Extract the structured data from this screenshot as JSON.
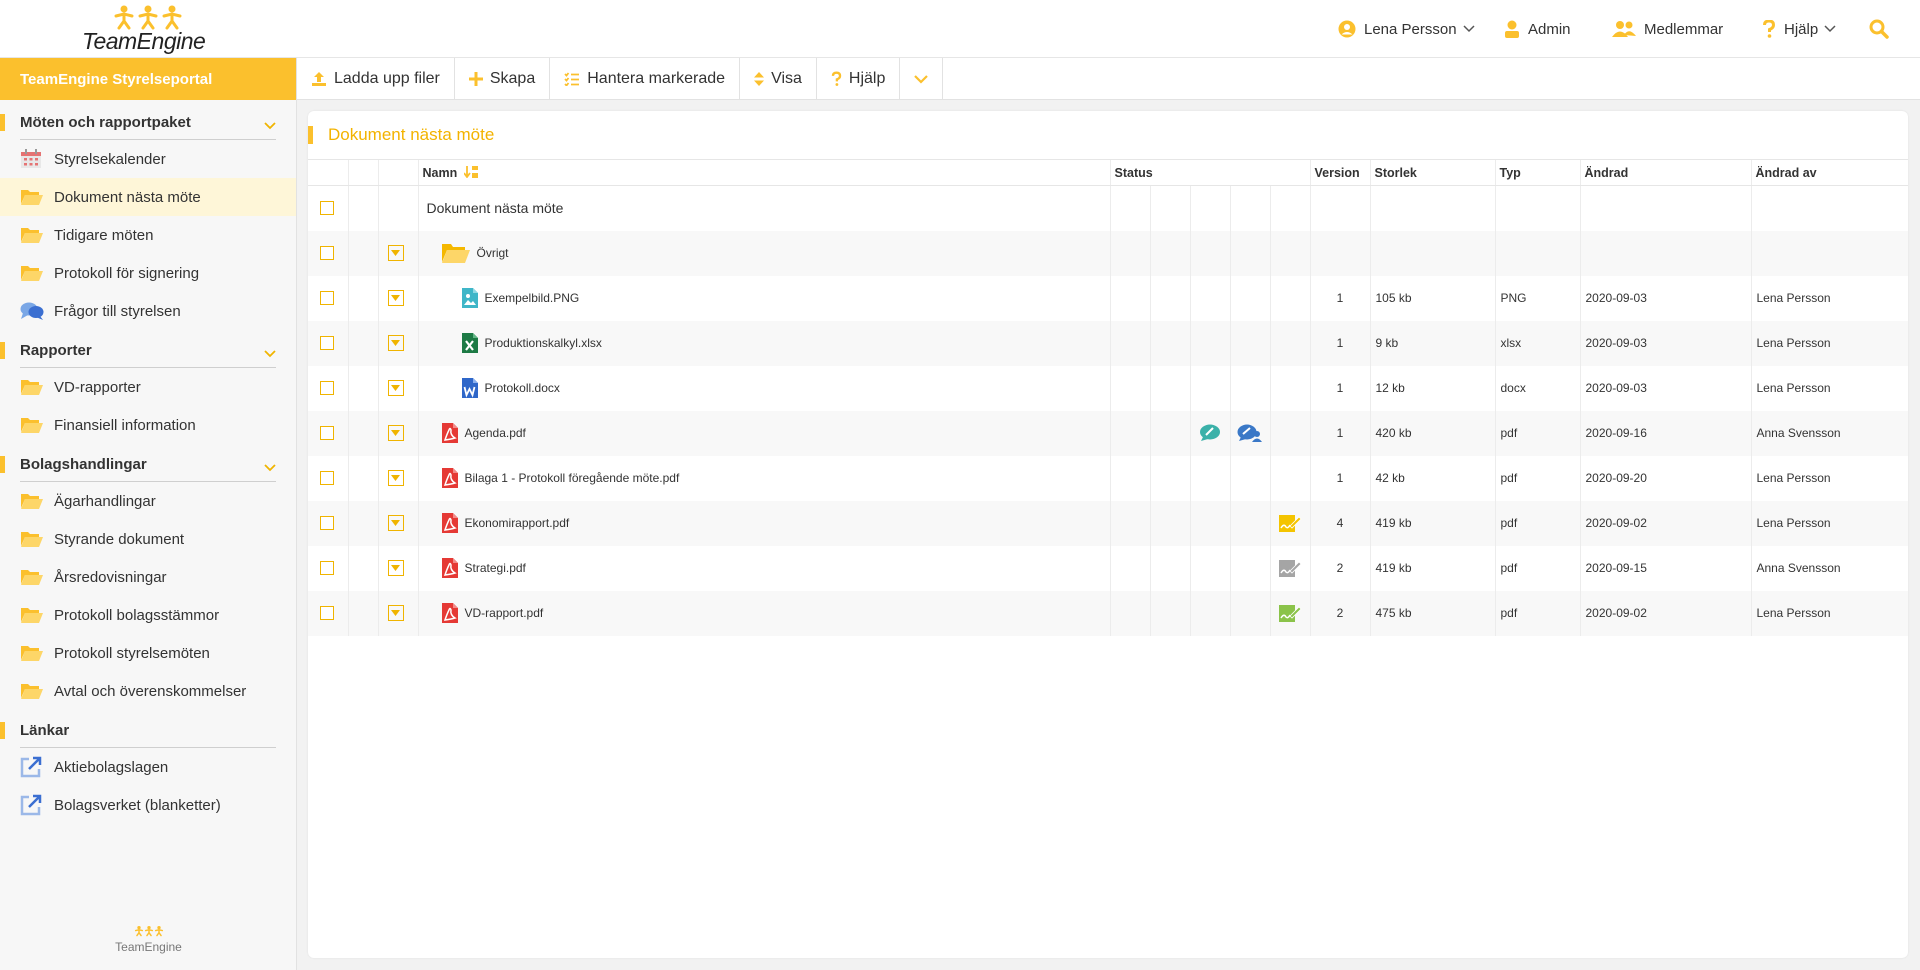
{
  "brand": {
    "name": "TeamEngine",
    "footer_name": "TeamEngine",
    "accent": "#fbc02d"
  },
  "header": {
    "user": "Lena Persson",
    "admin": "Admin",
    "members": "Medlemmar",
    "help": "Hjälp"
  },
  "sidebar": {
    "portal_title": "TeamEngine Styrelseportal",
    "sections": [
      {
        "title": "Möten och rapportpaket",
        "items": [
          "Styrelsekalender",
          "Dokument nästa möte",
          "Tidigare möten",
          "Protokoll för signering",
          "Frågor till styrelsen"
        ]
      },
      {
        "title": "Rapporter",
        "items": [
          "VD-rapporter",
          "Finansiell information"
        ]
      },
      {
        "title": "Bolagshandlingar",
        "items": [
          "Ägarhandlingar",
          "Styrande dokument",
          "Årsredovisningar",
          "Protokoll bolagsstämmor",
          "Protokoll styrelsemöten",
          "Avtal och överenskommelser"
        ]
      },
      {
        "title": "Länkar",
        "items": [
          "Aktiebolagslagen",
          "Bolagsverket (blanketter)"
        ]
      }
    ],
    "active_item": "Dokument nästa möte"
  },
  "toolbar": {
    "upload": "Ladda upp filer",
    "create": "Skapa",
    "manage": "Hantera markerade",
    "view": "Visa",
    "help": "Hjälp"
  },
  "panel": {
    "title": "Dokument nästa möte",
    "columns": {
      "name": "Namn",
      "status": "Status",
      "version": "Version",
      "size": "Storlek",
      "type": "Typ",
      "modified": "Ändrad",
      "modified_by": "Ändrad av"
    },
    "root_row": "Dokument nästa möte",
    "rows": [
      {
        "name": "Övrigt",
        "icon": "folder-icon",
        "level": 1,
        "version": "",
        "size": "",
        "type": "",
        "modified": "",
        "modified_by": "",
        "status": []
      },
      {
        "name": "Exempelbild.PNG",
        "icon": "image-file-icon",
        "level": 2,
        "version": "1",
        "size": "105 kb",
        "type": "PNG",
        "modified": "2020-09-03",
        "modified_by": "Lena Persson",
        "status": []
      },
      {
        "name": "Produktionskalkyl.xlsx",
        "icon": "excel-file-icon",
        "level": 2,
        "version": "1",
        "size": "9 kb",
        "type": "xlsx",
        "modified": "2020-09-03",
        "modified_by": "Lena Persson",
        "status": []
      },
      {
        "name": "Protokoll.docx",
        "icon": "word-file-icon",
        "level": 2,
        "version": "1",
        "size": "12 kb",
        "type": "docx",
        "modified": "2020-09-03",
        "modified_by": "Lena Persson",
        "status": []
      },
      {
        "name": "Agenda.pdf",
        "icon": "pdf-file-icon",
        "level": 1,
        "version": "1",
        "size": "420 kb",
        "type": "pdf",
        "modified": "2020-09-16",
        "modified_by": "Anna Svensson",
        "status": [
          "comment-icon",
          "comments-group-icon"
        ]
      },
      {
        "name": "Bilaga 1 - Protokoll föregående möte.pdf",
        "icon": "pdf-file-icon",
        "level": 1,
        "version": "1",
        "size": "42 kb",
        "type": "pdf",
        "modified": "2020-09-20",
        "modified_by": "Lena Persson",
        "status": []
      },
      {
        "name": "Ekonomirapport.pdf",
        "icon": "pdf-file-icon",
        "level": 1,
        "version": "4",
        "size": "419 kb",
        "type": "pdf",
        "modified": "2020-09-02",
        "modified_by": "Lena Persson",
        "status": [
          "sign-yellow-icon"
        ]
      },
      {
        "name": "Strategi.pdf",
        "icon": "pdf-file-icon",
        "level": 1,
        "version": "2",
        "size": "419 kb",
        "type": "pdf",
        "modified": "2020-09-15",
        "modified_by": "Anna Svensson",
        "status": [
          "sign-gray-icon"
        ]
      },
      {
        "name": "VD-rapport.pdf",
        "icon": "pdf-file-icon",
        "level": 1,
        "version": "2",
        "size": "475 kb",
        "type": "pdf",
        "modified": "2020-09-02",
        "modified_by": "Lena Persson",
        "status": [
          "sign-green-icon"
        ]
      }
    ]
  }
}
